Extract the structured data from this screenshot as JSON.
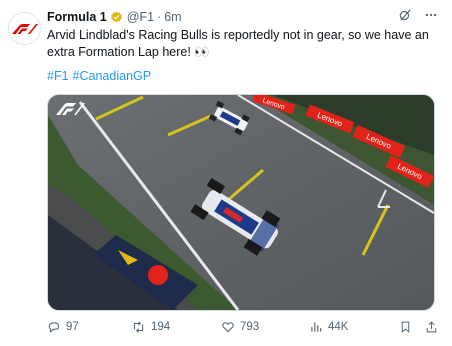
{
  "tweet": {
    "author_name": "Formula 1",
    "handle": "@F1",
    "separator": "·",
    "time": "6m",
    "text": "Arvid Lindblad's Racing Bulls is reportedly not in gear, so we have an extra Formation Lap here! 👀",
    "hashtags": [
      "#F1",
      "#CanadianGP"
    ],
    "media": {
      "logo": "F1",
      "banners": [
        "Lenovo",
        "Lenovo",
        "Lenovo",
        "Lenovo"
      ],
      "brand_colors": {
        "lenovo_red": "#e2231a",
        "track": "#5b5f62",
        "grass": "#3f5a32"
      }
    },
    "actions": {
      "replies": "97",
      "reposts": "194",
      "likes": "793",
      "views": "44K"
    }
  },
  "icons": [
    "f1-logo-icon",
    "verified-badge-icon",
    "grok-icon",
    "more-icon",
    "reply-icon",
    "repost-icon",
    "like-icon",
    "views-icon",
    "bookmark-icon",
    "share-icon"
  ],
  "colors": {
    "accent": "#1d9bf0",
    "muted": "#536471",
    "text": "#0f1419",
    "verified": "#e2b719"
  }
}
